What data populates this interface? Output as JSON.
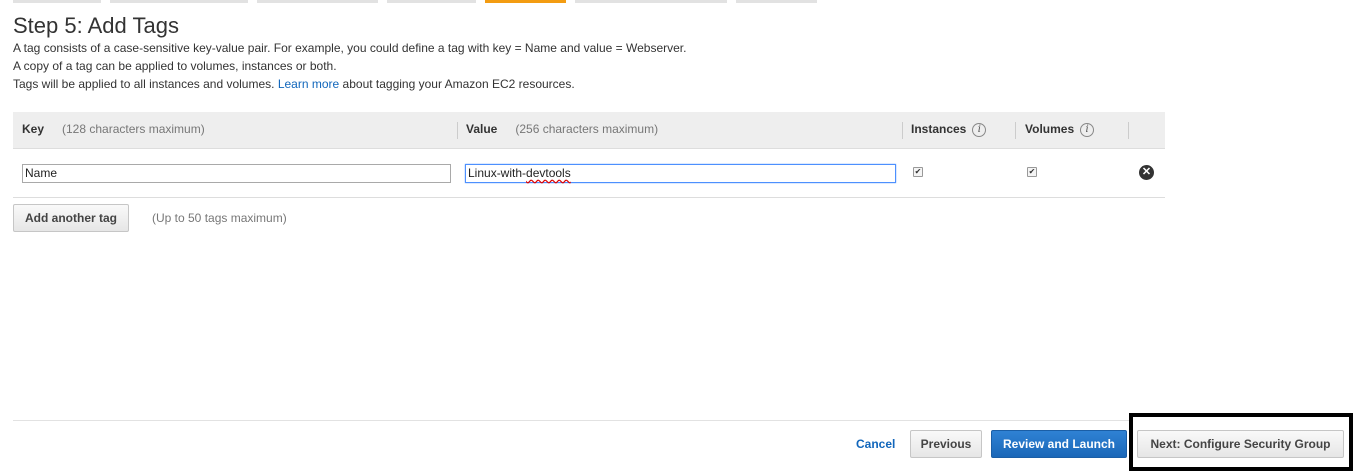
{
  "wizard": {
    "step_title": "Step 5: Add Tags",
    "description_lines": [
      "A tag consists of a case-sensitive key-value pair. For example, you could define a tag with key = Name and value = Webserver.",
      "A copy of a tag can be applied to volumes, instances or both."
    ],
    "line3_prefix": "Tags will be applied to all instances and volumes.",
    "learn_more": "Learn more",
    "line3_suffix": "about tagging your Amazon EC2 resources.",
    "accent_color": "#f39c12"
  },
  "table": {
    "headers": {
      "key": "Key",
      "key_hint": "(128 characters maximum)",
      "value": "Value",
      "value_hint": "(256 characters maximum)",
      "instances": "Instances",
      "volumes": "Volumes"
    },
    "info_glyph": "i",
    "rows": [
      {
        "key": "Name",
        "value_plain": "Linux-with-",
        "value_misspelled": "devtools",
        "instances": true,
        "volumes": true
      }
    ],
    "check_glyph": "✔",
    "remove_glyph": "✕"
  },
  "actions": {
    "add_tag": "Add another tag",
    "add_tag_hint": "(Up to 50 tags maximum)",
    "cancel": "Cancel",
    "previous": "Previous",
    "review_launch": "Review and Launch",
    "next": "Next: Configure Security Group",
    "link_color": "#1166bb",
    "primary_color": "#1a67b8"
  }
}
